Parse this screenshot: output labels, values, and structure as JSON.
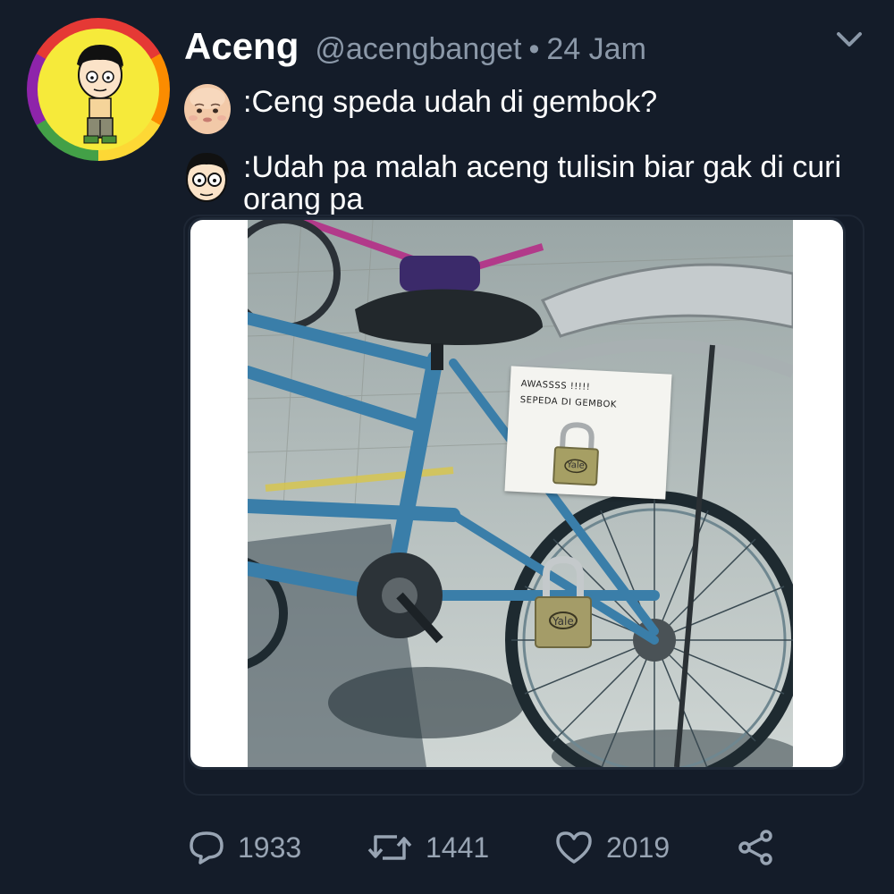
{
  "tweet": {
    "display_name": "Aceng",
    "handle": "@acengbanget",
    "separator": "•",
    "time": "24 Jam",
    "lines": [
      {
        "speaker_icon": "baby-face-icon",
        "text": ":Ceng speda udah di gembok?"
      },
      {
        "speaker_icon": "aceng-face-icon",
        "text": ":Udah pa malah aceng tulisin biar gak di curi orang pa"
      }
    ],
    "media": {
      "sign_line1": "AWASSSS !!!!!",
      "sign_line2": "SEPEDA DI GEMBOK",
      "lock_brand": "Yale"
    },
    "actions": {
      "reply_count": "1933",
      "retweet_count": "1441",
      "like_count": "2019",
      "share_icon": "share-icon"
    }
  },
  "colors": {
    "background": "#141c29",
    "text": "#ffffff",
    "muted": "#8b98a8"
  }
}
